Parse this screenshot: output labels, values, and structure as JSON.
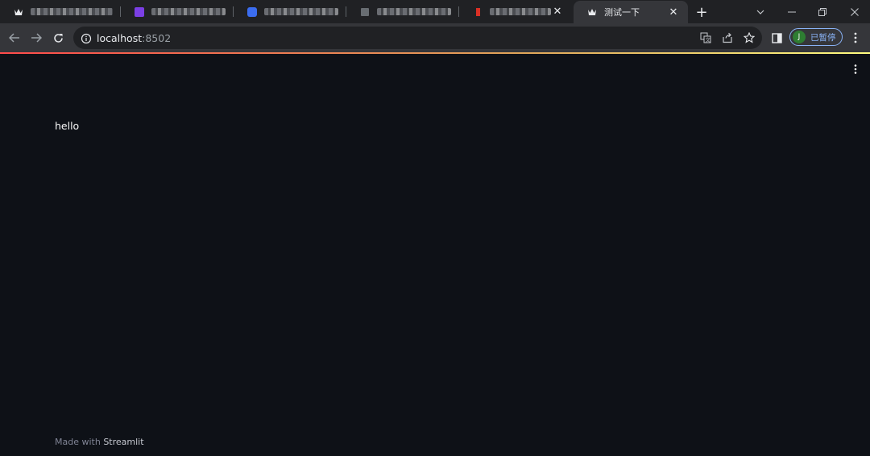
{
  "tabs": [
    {
      "title": "",
      "blurred": true,
      "favicon": "crown-icon"
    },
    {
      "title": "",
      "blurred": true,
      "favicon": "purple-favicon",
      "favicon_color": "#7b3fe4"
    },
    {
      "title": "",
      "blurred": true,
      "favicon": "blue-favicon",
      "favicon_color": "#3b6df0"
    },
    {
      "title": "",
      "blurred": true,
      "favicon": "blank-favicon"
    },
    {
      "title": "",
      "blurred": true,
      "favicon": "red-favicon",
      "favicon_color": "#d93025"
    },
    {
      "title": "测试一下",
      "active": true,
      "favicon": "crown-icon"
    }
  ],
  "toolbar": {
    "url_host": "localhost",
    "url_port": ":8502"
  },
  "profile": {
    "initial": "J",
    "label": "已暂停"
  },
  "content": {
    "text": "hello"
  },
  "footer": {
    "prefix": "Made with ",
    "brand": "Streamlit"
  },
  "colors": {
    "page_bg": "#0e1117",
    "accent_gradient_start": "#ff4b4b",
    "accent_gradient_end": "#fffd80",
    "profile_border": "#8ab4f8"
  }
}
